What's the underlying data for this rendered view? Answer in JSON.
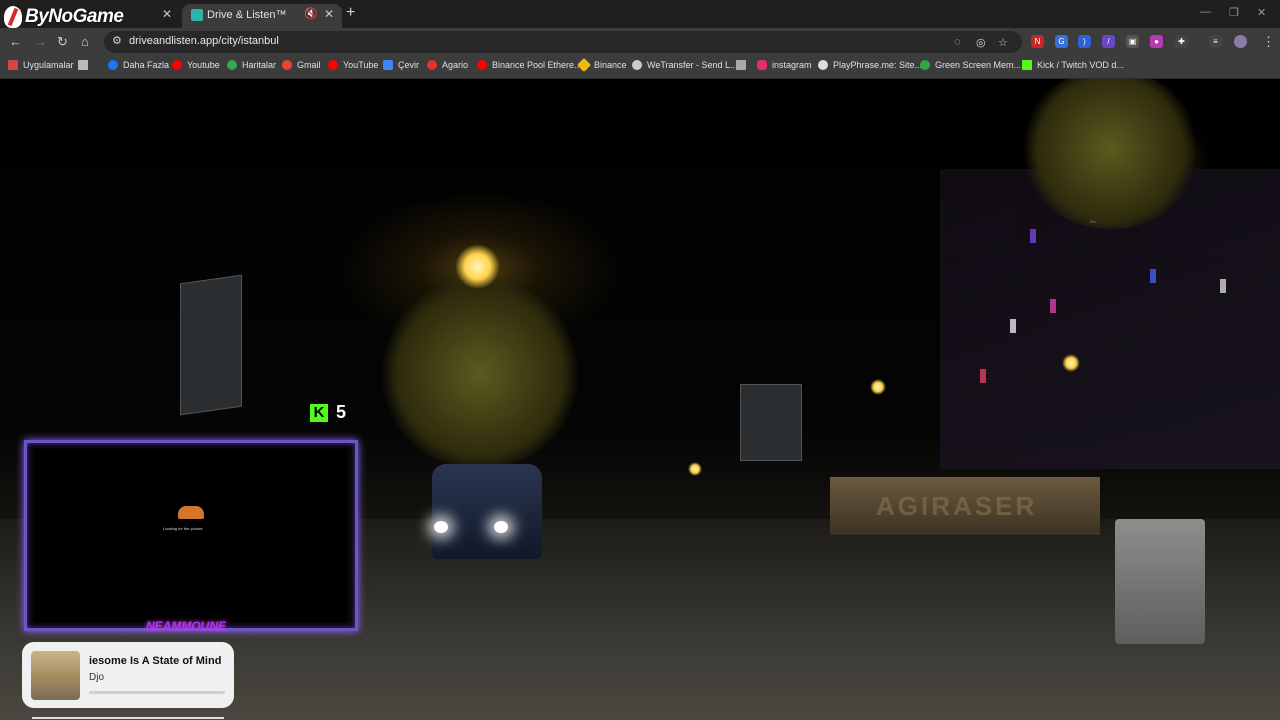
{
  "branding": {
    "logo_text": "ByNoGame"
  },
  "tabs": [
    {
      "title": "",
      "favicon_color": "#d63b3b",
      "active": false
    },
    {
      "title": "Drive & Listen™",
      "favicon_color": "#2fb3a5",
      "active": true
    }
  ],
  "toolbar": {
    "url": "driveandlisten.app/city/istanbul"
  },
  "bookmarks": [
    {
      "label": "Uygulamalar",
      "icon": "apps-grid-icon",
      "color": "#d64545"
    },
    {
      "label": "",
      "icon": "grid-icon",
      "color": "#bbbbbb"
    },
    {
      "label": "Daha Fazla",
      "icon": "facebook-icon",
      "color": "#1877f2"
    },
    {
      "label": "Youtube",
      "icon": "youtube-icon",
      "color": "#ff0000"
    },
    {
      "label": "Haritalar",
      "icon": "maps-icon",
      "color": "#34a853"
    },
    {
      "label": "Gmail",
      "icon": "gmail-icon",
      "color": "#ea4335"
    },
    {
      "label": "YouTube",
      "icon": "youtube-icon",
      "color": "#ff0000"
    },
    {
      "label": "Çevir",
      "icon": "translate-icon",
      "color": "#4285f4"
    },
    {
      "label": "Agario",
      "icon": "agario-icon",
      "color": "#e03030"
    },
    {
      "label": "Binance Pool Ethere...",
      "icon": "youtube-icon",
      "color": "#ff0000"
    },
    {
      "label": "Binance",
      "icon": "binance-icon",
      "color": "#f0b90b"
    },
    {
      "label": "WeTransfer - Send L...",
      "icon": "wetransfer-icon",
      "color": "#cccccc"
    },
    {
      "label": "",
      "icon": "bookmark-icon",
      "color": "#aaaaaa"
    },
    {
      "label": "instagram",
      "icon": "instagram-icon",
      "color": "#e1306c"
    },
    {
      "label": "PlayPhrase.me: Site...",
      "icon": "playphrase-icon",
      "color": "#dddddd"
    },
    {
      "label": "Green Screen Mem...",
      "icon": "greenscreen-icon",
      "color": "#2aa84a"
    },
    {
      "label": "Kick / Twitch VOD d...",
      "icon": "kick-icon",
      "color": "#53fc18"
    }
  ],
  "overlay": {
    "kick_count": "5",
    "cam_loading_text": "Looking for the picture",
    "streamer_name": "NEAMMOUNE"
  },
  "music": {
    "track": "iesome Is A State of Mind",
    "artist": "Djo",
    "progress": 0.0
  },
  "scene": {
    "wall_sign": "AGIRASER"
  }
}
